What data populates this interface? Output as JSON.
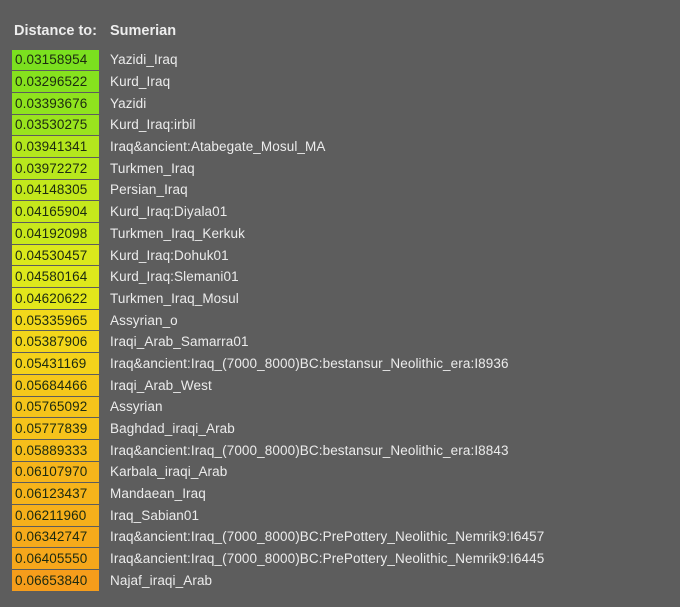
{
  "header": {
    "label": "Distance to:",
    "target": "Sumerian"
  },
  "rows": [
    {
      "distance": "0.03158954",
      "population": "Yazidi_Iraq",
      "color": "#7be01f"
    },
    {
      "distance": "0.03296522",
      "population": "Kurd_Iraq",
      "color": "#86e21e"
    },
    {
      "distance": "0.03393676",
      "population": "Yazidi",
      "color": "#8fe31e"
    },
    {
      "distance": "0.03530275",
      "population": "Kurd_Iraq:irbil",
      "color": "#9ae41e"
    },
    {
      "distance": "0.03941341",
      "population": "Iraq&ancient:Atabegate_Mosul_MA",
      "color": "#b4e71d"
    },
    {
      "distance": "0.03972272",
      "population": "Turkmen_Iraq",
      "color": "#b8e81d"
    },
    {
      "distance": "0.04148305",
      "population": "Persian_Iraq",
      "color": "#c3e81c"
    },
    {
      "distance": "0.04165904",
      "population": "Kurd_Iraq:Diyala01",
      "color": "#c6e81c"
    },
    {
      "distance": "0.04192098",
      "population": "Turkmen_Iraq_Kerkuk",
      "color": "#c9e81c"
    },
    {
      "distance": "0.04530457",
      "population": "Kurd_Iraq:Dohuk01",
      "color": "#dbe81c"
    },
    {
      "distance": "0.04580164",
      "population": "Kurd_Iraq:Slemani01",
      "color": "#dee81c"
    },
    {
      "distance": "0.04620622",
      "population": "Turkmen_Iraq_Mosul",
      "color": "#e2e71b"
    },
    {
      "distance": "0.05335965",
      "population": "Assyrian_o",
      "color": "#f2d91b"
    },
    {
      "distance": "0.05387906",
      "population": "Iraqi_Arab_Samarra01",
      "color": "#f3d61b"
    },
    {
      "distance": "0.05431169",
      "population": "Iraq&ancient:Iraq_(7000_8000)BC:bestansur_Neolithic_era:I8936",
      "color": "#f4d21b"
    },
    {
      "distance": "0.05684466",
      "population": "Iraqi_Arab_West",
      "color": "#f5c81b"
    },
    {
      "distance": "0.05765092",
      "population": "Assyrian",
      "color": "#f5c41b"
    },
    {
      "distance": "0.05777839",
      "population": "Baghdad_iraqi_Arab",
      "color": "#f6c31b"
    },
    {
      "distance": "0.05889333",
      "population": "Iraq&ancient:Iraq_(7000_8000)BC:bestansur_Neolithic_era:I8843",
      "color": "#f6be1b"
    },
    {
      "distance": "0.06107970",
      "population": "Karbala_iraqi_Arab",
      "color": "#f6b51b"
    },
    {
      "distance": "0.06123437",
      "population": "Mandaean_Iraq",
      "color": "#f6b41b"
    },
    {
      "distance": "0.06211960",
      "population": "Iraq_Sabian01",
      "color": "#f6b01b"
    },
    {
      "distance": "0.06342747",
      "population": "Iraq&ancient:Iraq_(7000_8000)BC:PrePottery_Neolithic_Nemrik9:I6457",
      "color": "#f6aa1b"
    },
    {
      "distance": "0.06405550",
      "population": "Iraq&ancient:Iraq_(7000_8000)BC:PrePottery_Neolithic_Nemrik9:I6445",
      "color": "#f6a71b"
    },
    {
      "distance": "0.06653840",
      "population": "Najaf_iraqi_Arab",
      "color": "#f69d1b"
    }
  ]
}
